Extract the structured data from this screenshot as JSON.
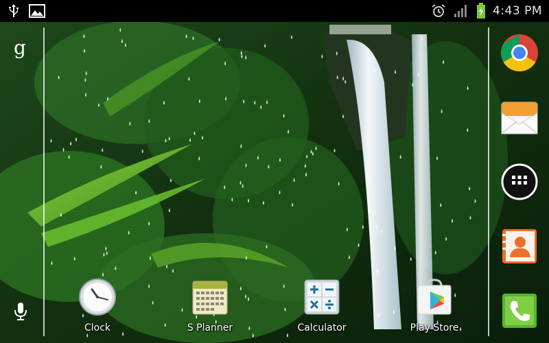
{
  "status_bar": {
    "time": "4:43 PM",
    "left_icons": [
      "usb-icon",
      "gallery-icon"
    ],
    "right_icons": [
      "alarm-icon",
      "signal-icon",
      "battery-charging-icon"
    ]
  },
  "left_bar": {
    "search_glyph": "g",
    "mic_icon": "microphone-icon"
  },
  "dock": {
    "items": [
      {
        "name": "chrome",
        "icon": "chrome-icon"
      },
      {
        "name": "email",
        "icon": "email-icon"
      },
      {
        "name": "apps",
        "icon": "apps-grid-icon"
      },
      {
        "name": "contacts",
        "icon": "contacts-icon"
      },
      {
        "name": "phone",
        "icon": "phone-icon"
      }
    ]
  },
  "home_apps": [
    {
      "label": "Clock",
      "icon": "clock-icon"
    },
    {
      "label": "S Planner",
      "icon": "calendar-icon"
    },
    {
      "label": "Calculator",
      "icon": "calculator-icon"
    },
    {
      "label": "Play Store",
      "icon": "play-store-icon"
    }
  ],
  "colors": {
    "status_bar_bg": "#000000",
    "battery_green": "#7ec72f",
    "chrome_red": "#db4437",
    "chrome_yellow": "#f4c20d",
    "chrome_green": "#0f9d58",
    "chrome_blue": "#4285f4"
  }
}
